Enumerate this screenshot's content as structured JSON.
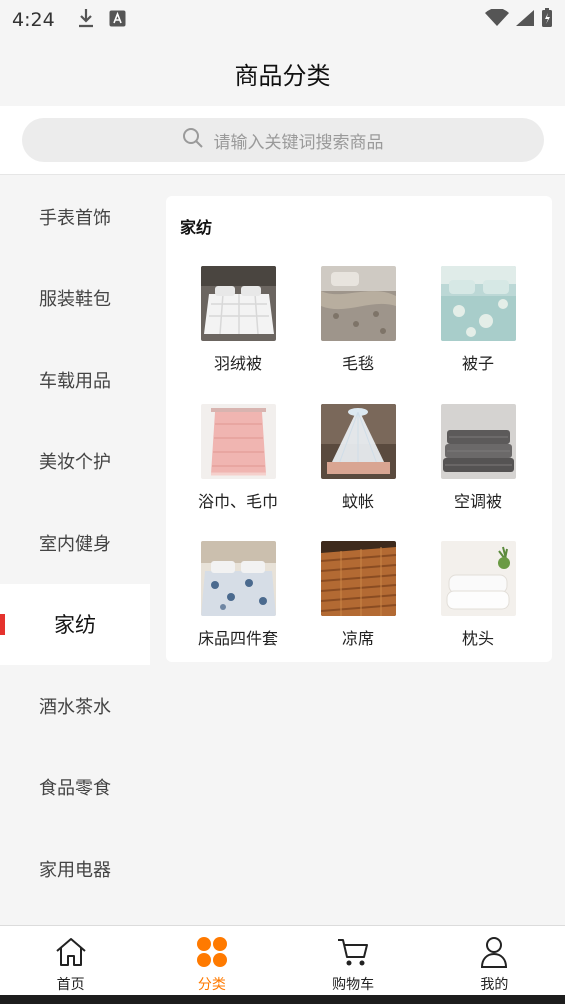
{
  "status_bar": {
    "time": "4:24",
    "icons": [
      "download-icon",
      "font-a-icon",
      "wifi-icon",
      "signal-icon",
      "battery-charging-icon"
    ]
  },
  "header": {
    "title": "商品分类"
  },
  "search": {
    "placeholder": "请输入关键词搜索商品",
    "icon": "search-icon"
  },
  "sidebar": {
    "items": [
      {
        "label": "手表首饰"
      },
      {
        "label": "服装鞋包"
      },
      {
        "label": "车载用品"
      },
      {
        "label": "美妆个护"
      },
      {
        "label": "室内健身"
      },
      {
        "label": "家纺",
        "active": true
      },
      {
        "label": "酒水茶水"
      },
      {
        "label": "食品零食"
      },
      {
        "label": "家用电器"
      }
    ],
    "active_color": "#e5322d"
  },
  "content": {
    "category_title": "家纺",
    "items": [
      {
        "label": "羽绒被"
      },
      {
        "label": "毛毯"
      },
      {
        "label": "被子"
      },
      {
        "label": "浴巾、毛巾"
      },
      {
        "label": "蚊帐"
      },
      {
        "label": "空调被"
      },
      {
        "label": "床品四件套"
      },
      {
        "label": "凉席"
      },
      {
        "label": "枕头"
      }
    ]
  },
  "bottom_nav": {
    "items": [
      {
        "label": "首页",
        "icon": "home-icon"
      },
      {
        "label": "分类",
        "icon": "category-icon",
        "active": true
      },
      {
        "label": "购物车",
        "icon": "cart-icon"
      },
      {
        "label": "我的",
        "icon": "user-icon"
      }
    ],
    "active_color": "#ff7a00"
  }
}
